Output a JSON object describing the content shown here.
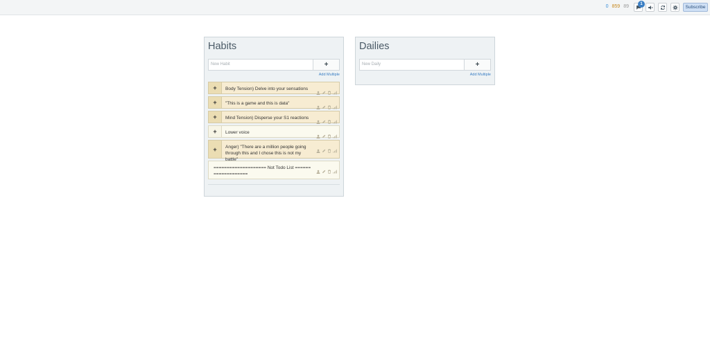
{
  "topbar": {
    "gems": "0",
    "gold": "859",
    "silver": "89",
    "notification_count": "1",
    "subscribe_label": "Subscribe",
    "icons": [
      "chat-icon",
      "sound-icon",
      "sync-icon",
      "settings-gear-icon"
    ]
  },
  "habits": {
    "title": "Habits",
    "input_placeholder": "New Habit",
    "add_label": "+",
    "add_multiple": "Add Multiple",
    "tasks": [
      {
        "plus": "+",
        "text": "Body Tension) Delve into your sensations"
      },
      {
        "plus": "+",
        "text": "\"This is a game and this is data\""
      },
      {
        "plus": "+",
        "text": "Mind Tension) Disperse your S1 reactions"
      },
      {
        "plus": "+",
        "text": "Lower voice"
      },
      {
        "plus": "+",
        "text": "Anger) \"There are a million people going through this and I chose this is not my battle\""
      },
      {
        "plus": "",
        "text": "==================== Not Todo List ==================="
      }
    ]
  },
  "dailies": {
    "title": "Dailies",
    "input_placeholder": "New Daily",
    "add_label": "+",
    "add_multiple": "Add Multiple"
  },
  "colors": {
    "accent_blue": "#3b7fc4",
    "task_tan": "#f7ecd2",
    "task_neutral": "#fbfaef"
  }
}
